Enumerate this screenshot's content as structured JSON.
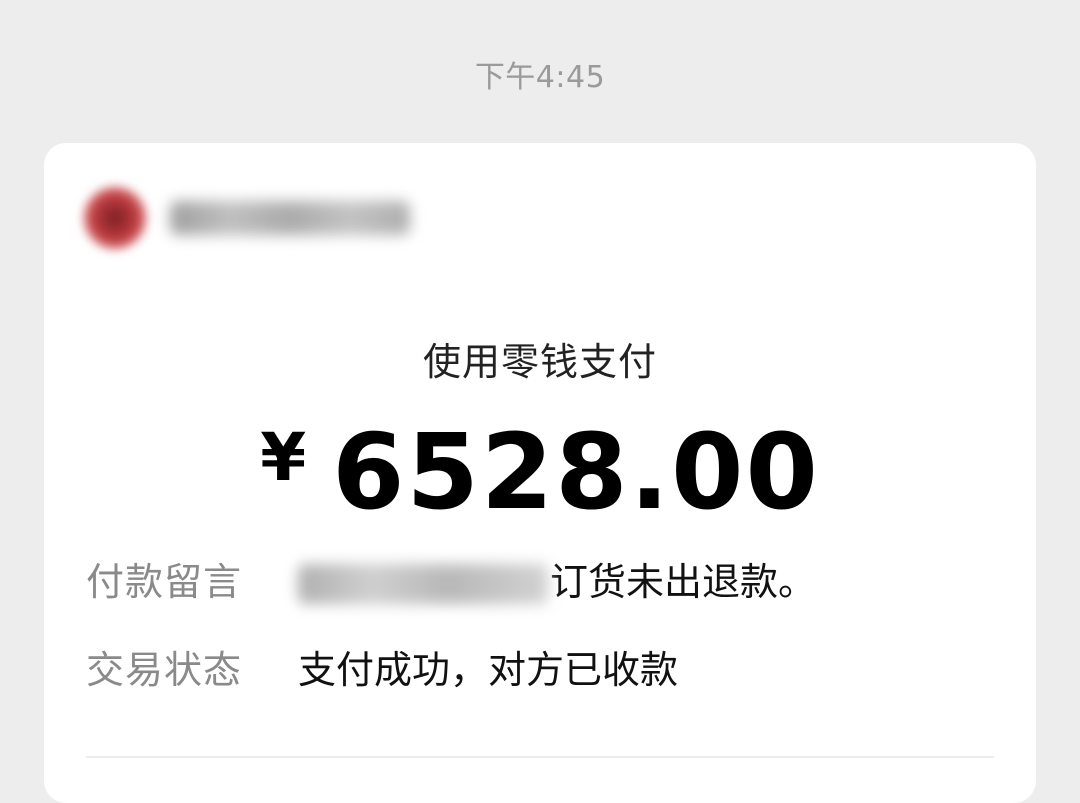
{
  "timestamp": "下午4:45",
  "card": {
    "payment_method": "使用零钱支付",
    "currency_symbol": "¥",
    "amount": "6528.00",
    "note": {
      "label": "付款留言",
      "value_suffix": "订货未出退款。"
    },
    "status": {
      "label": "交易状态",
      "value": "支付成功，对方已收款"
    }
  }
}
